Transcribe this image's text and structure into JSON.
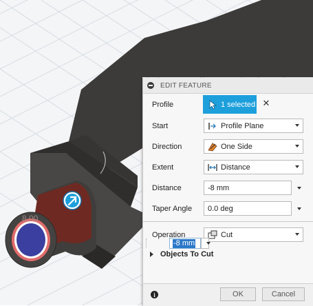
{
  "viewport": {
    "dimension_text": "8.00",
    "dim_input_value": "-8 mm"
  },
  "panel": {
    "title": "EDIT FEATURE",
    "profile": {
      "label": "Profile",
      "button_text": "1 selected",
      "clear_icon": "close-icon"
    },
    "start": {
      "label": "Start",
      "value": "Profile Plane",
      "icon": "profile-plane-icon"
    },
    "direction": {
      "label": "Direction",
      "value": "One Side",
      "icon": "one-side-icon"
    },
    "extent": {
      "label": "Extent",
      "value": "Distance",
      "icon": "distance-icon"
    },
    "distance": {
      "label": "Distance",
      "value": "-8 mm"
    },
    "taper": {
      "label": "Taper Angle",
      "value": "0.0 deg"
    },
    "operation": {
      "label": "Operation",
      "value": "Cut",
      "icon": "cut-icon"
    },
    "objects_to_cut": {
      "label": "Objects To Cut"
    },
    "ok_label": "OK",
    "cancel_label": "Cancel"
  },
  "colors": {
    "accent": "#1d9fdc",
    "body": "#3c3b39",
    "cut_face": "#6e2a22",
    "profile_fill": "#3a3fa0",
    "profile_ring": "#e05a5a"
  }
}
